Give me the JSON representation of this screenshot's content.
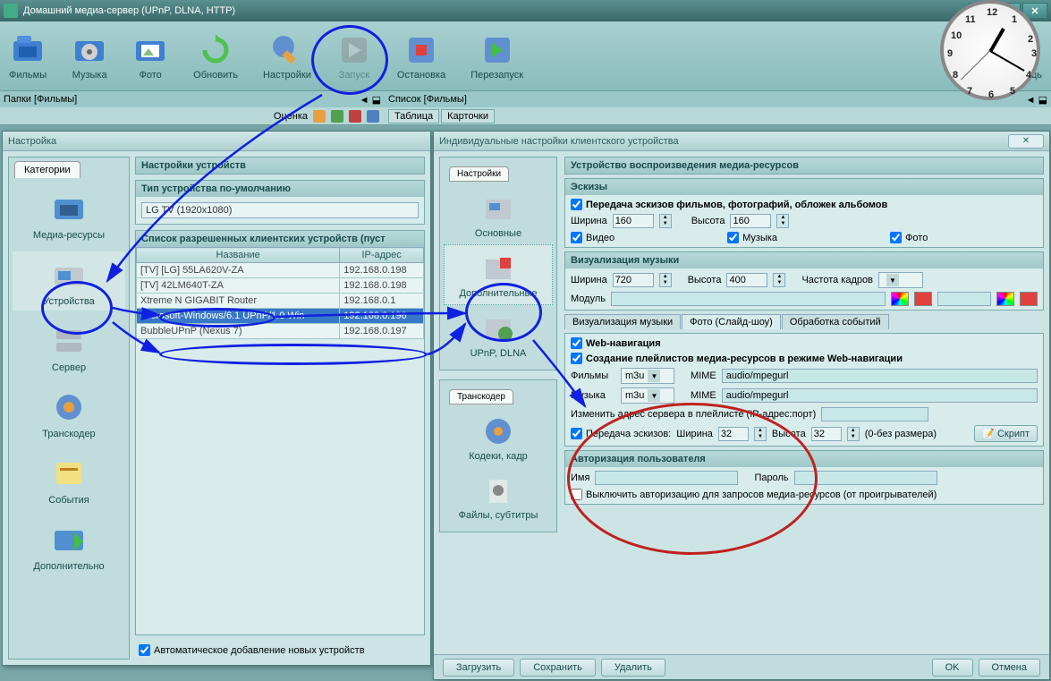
{
  "window": {
    "title": "Домашний медиа-сервер (UPnP, DLNA, HTTP)"
  },
  "toolbar": {
    "films": "Фильмы",
    "music": "Музыка",
    "photo": "Фото",
    "refresh": "Обновить",
    "settings": "Настройки",
    "start": "Запуск",
    "stop": "Остановка",
    "restart": "Перезапуск",
    "help": "Помощь"
  },
  "tabrow": {
    "left": "Папки [Фильмы]",
    "right": "Список [Фильмы]",
    "rating": "Оценка",
    "tab_table": "Таблица",
    "tab_cards": "Карточки"
  },
  "settings_dlg": {
    "title": "Настройка",
    "categories_tab": "Категории",
    "cats": [
      "Медиа-ресурсы",
      "Устройства",
      "Сервер",
      "Транскодер",
      "События",
      "Дополнительно"
    ],
    "device_settings": "Настройки устройств",
    "default_type": "Тип устройства по-умолчанию",
    "default_value": "LG TV (1920x1080)",
    "allowed_list": "Список разрешенных клиентских устройств (пуст",
    "col_name": "Название",
    "col_ip": "IP-адрес",
    "devices": [
      {
        "name": "[TV] [LG] 55LA620V-ZA",
        "ip": "192.168.0.198"
      },
      {
        "name": "[TV] 42LM640T-ZA",
        "ip": "192.168.0.198"
      },
      {
        "name": "Xtreme N GIGABIT Router",
        "ip": "192.168.0.1"
      },
      {
        "name": "Microsoft-Windows/6.1 UPnP/1.0 Win",
        "ip": "192.168.0.196"
      },
      {
        "name": "BubbleUPnP (Nexus 7)",
        "ip": "192.168.0.197"
      }
    ],
    "auto_add": "Автоматическое добавление новых устройств"
  },
  "details_dlg": {
    "title": "Индивидуальные настройки клиентского устройства",
    "nav_settings": "Настройки",
    "nav_items1": [
      "Основные",
      "Дополнительные",
      "UPnP, DLNA"
    ],
    "nav_transcoder": "Транскодер",
    "nav_items2": [
      "Кодеки, кадр",
      "Файлы, субтитры"
    ],
    "main_head": "Устройство воспроизведения медиа-ресурсов",
    "thumbs": {
      "head": "Эскизы",
      "send": "Передача эскизов фильмов, фотографий, обложек альбомов",
      "width": "Ширина",
      "wval": "160",
      "height": "Высота",
      "hval": "160",
      "video": "Видео",
      "music": "Музыка",
      "photo": "Фото"
    },
    "musicvis": {
      "head": "Визуализация музыки",
      "width": "Ширина",
      "wval": "720",
      "height": "Высота",
      "hval": "400",
      "fps": "Частота кадров",
      "module": "Модуль"
    },
    "subtabs": [
      "Визуализация музыки",
      "Фото (Слайд-шоу)",
      "Обработка событий"
    ],
    "webnav": {
      "head": "Web-навигация",
      "create_playlists": "Создание плейлистов медиа-ресурсов в режиме Web-навигации",
      "films": "Фильмы",
      "films_val": "m3u",
      "music": "Музыка",
      "music_val": "m3u",
      "mime": "MIME",
      "mime_val": "audio/mpegurl",
      "change_addr": "Изменить адрес сервера в плейлисте (IP-адрес:порт)",
      "send_thumbs": "Передача эскизов:",
      "width": "Ширина",
      "wval": "32",
      "height": "Высота",
      "hval": "32",
      "zero_note": "(0-без размера)",
      "script": "Скрипт"
    },
    "auth": {
      "head": "Авторизация пользователя",
      "name": "Имя",
      "password": "Пароль",
      "disable": "Выключить авторизацию для запросов медиа-ресурсов (от проигрывателей)"
    },
    "buttons": {
      "load": "Загрузить",
      "save": "Сохранить",
      "delete": "Удалить",
      "ok": "OK",
      "cancel": "Отмена"
    }
  },
  "clock": {
    "numbers": [
      "12",
      "1",
      "2",
      "3",
      "4",
      "5",
      "6",
      "7",
      "8",
      "9",
      "10",
      "11"
    ]
  }
}
